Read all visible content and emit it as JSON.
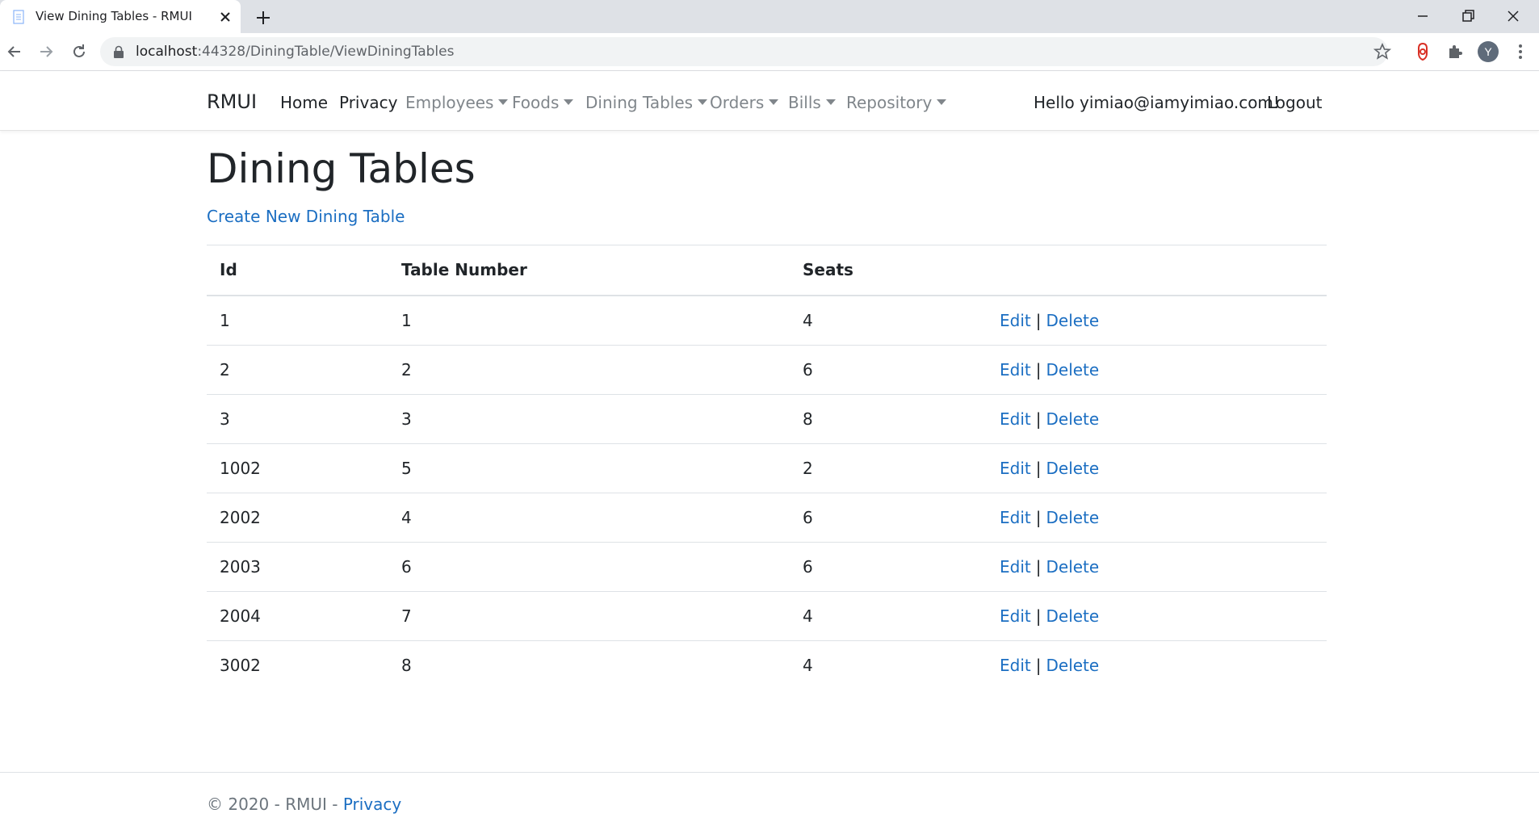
{
  "browser": {
    "tab_title": "View Dining Tables - RMUI",
    "url_host": "localhost",
    "url_port": ":44328",
    "url_path": "/DiningTable/ViewDiningTables",
    "avatar_letter": "Y"
  },
  "navbar": {
    "brand": "RMUI",
    "links": [
      {
        "label": "Home",
        "dropdown": false
      },
      {
        "label": "Privacy",
        "dropdown": false
      },
      {
        "label": "Employees",
        "dropdown": true
      },
      {
        "label": "Foods",
        "dropdown": true
      },
      {
        "label": "Dining Tables",
        "dropdown": true
      },
      {
        "label": "Orders",
        "dropdown": true
      },
      {
        "label": "Bills",
        "dropdown": true
      },
      {
        "label": "Repository",
        "dropdown": true
      }
    ],
    "greeting": "Hello yimiao@iamyimiao.com!",
    "logout": "Logout"
  },
  "main": {
    "title": "Dining Tables",
    "create_link": "Create New Dining Table",
    "table": {
      "headers": [
        "Id",
        "Table Number",
        "Seats",
        ""
      ],
      "rows": [
        {
          "id": "1",
          "table_number": "1",
          "seats": "4"
        },
        {
          "id": "2",
          "table_number": "2",
          "seats": "6"
        },
        {
          "id": "3",
          "table_number": "3",
          "seats": "8"
        },
        {
          "id": "1002",
          "table_number": "5",
          "seats": "2"
        },
        {
          "id": "2002",
          "table_number": "4",
          "seats": "6"
        },
        {
          "id": "2003",
          "table_number": "6",
          "seats": "6"
        },
        {
          "id": "2004",
          "table_number": "7",
          "seats": "4"
        },
        {
          "id": "3002",
          "table_number": "8",
          "seats": "4"
        }
      ],
      "edit_label": "Edit",
      "delete_label": "Delete",
      "separator": "|"
    }
  },
  "footer": {
    "text": "© 2020 - RMUI - ",
    "privacy_link": "Privacy"
  },
  "colors": {
    "link": "#1b6ec2",
    "text": "#212529",
    "muted": "#6c757d"
  }
}
